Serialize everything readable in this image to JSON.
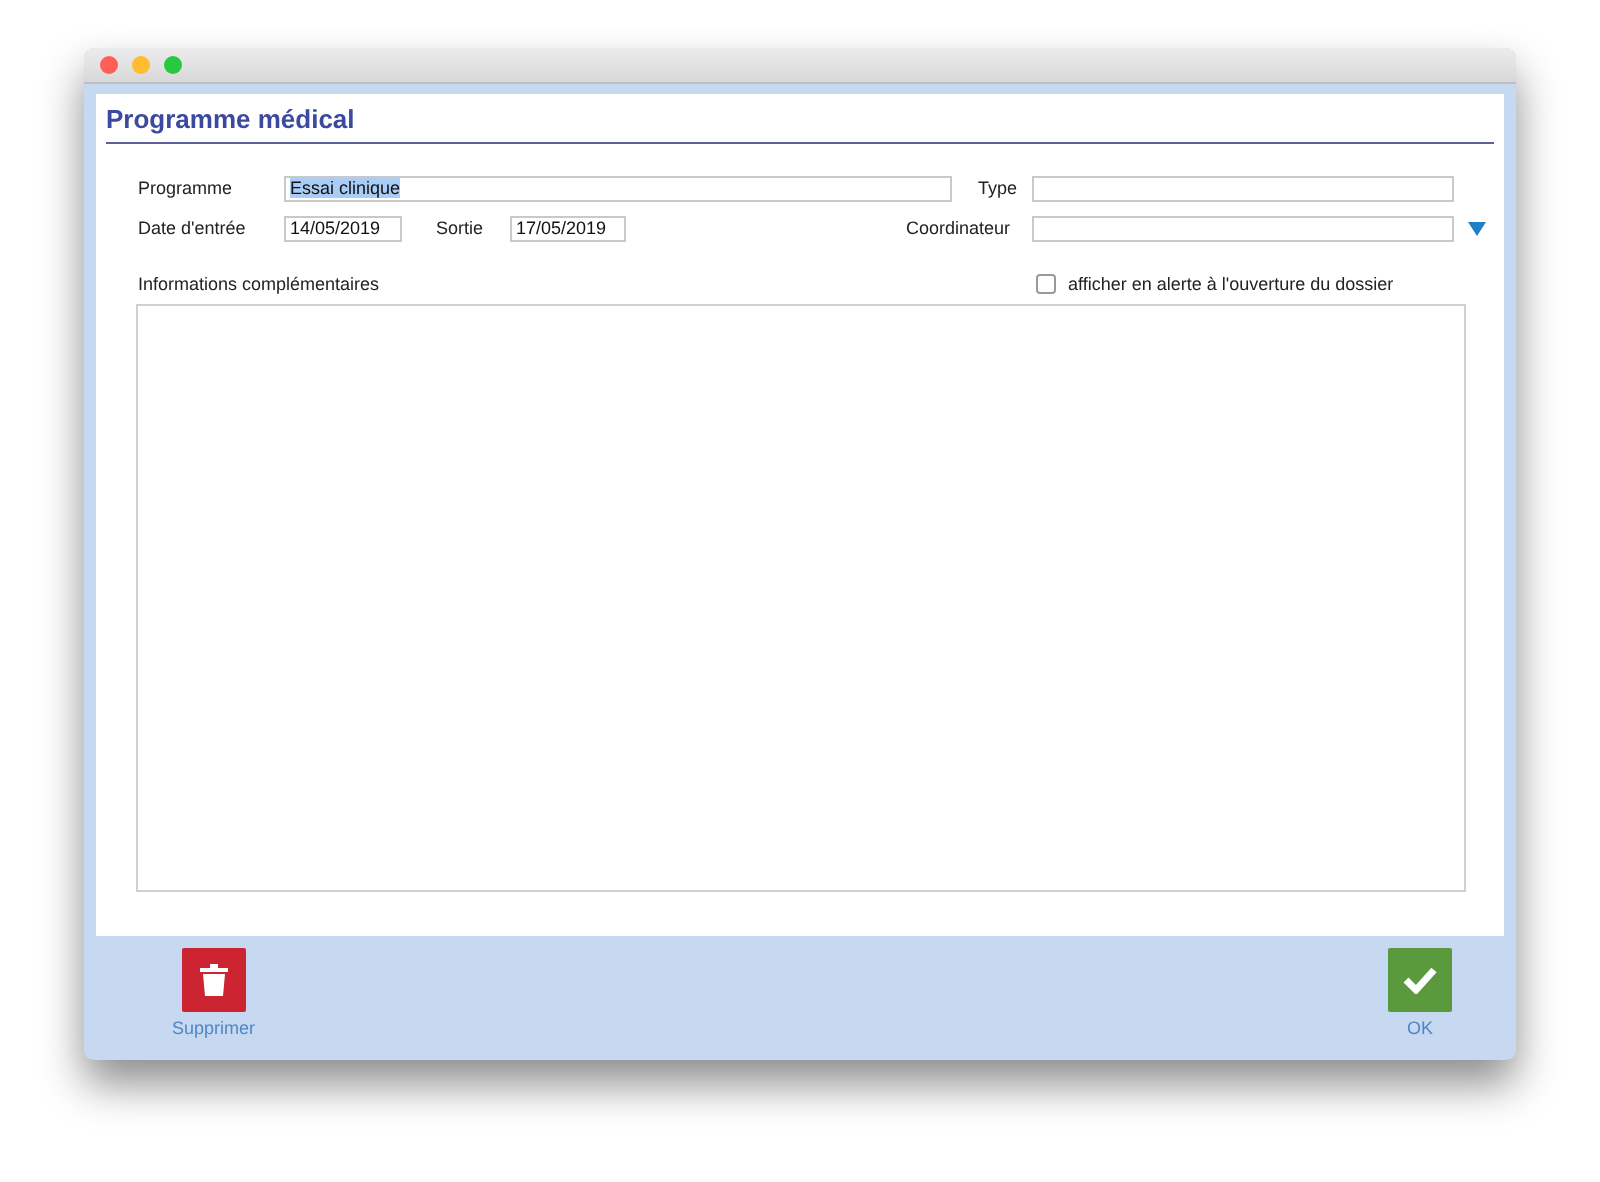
{
  "window": {
    "title": "Programme médical"
  },
  "form": {
    "programme": {
      "label": "Programme",
      "value": "Essai clinique",
      "text_selected": true
    },
    "type": {
      "label": "Type"
    },
    "date_entree": {
      "label": "Date d'entrée",
      "value": "14/05/2019"
    },
    "sortie": {
      "label": "Sortie",
      "value": "17/05/2019"
    },
    "coordinateur": {
      "label": "Coordinateur"
    },
    "informations": {
      "label": "Informations complémentaires"
    },
    "alerte": {
      "label": "afficher en alerte à l'ouverture du dossier",
      "checked": false
    }
  },
  "buttons": [
    {
      "kind": "delete",
      "label": "Supprimer"
    },
    {
      "kind": "ok",
      "label": "OK"
    }
  ]
}
